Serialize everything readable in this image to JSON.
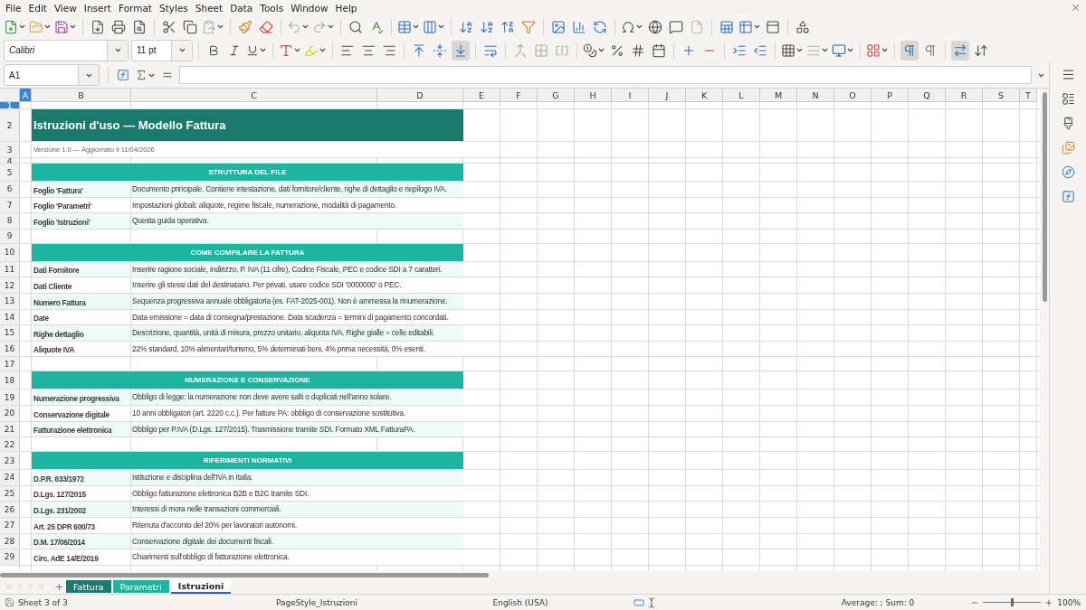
{
  "menu": [
    "File",
    "Edit",
    "View",
    "Insert",
    "Format",
    "Styles",
    "Sheet",
    "Data",
    "Tools",
    "Window",
    "Help"
  ],
  "font_name": {
    "value": "Calibri"
  },
  "font_size": {
    "value": "11 pt"
  },
  "format_toggles": [
    {
      "selected": true
    },
    {
      "selected": true
    },
    {
      "selected": false
    },
    {
      "selected": true
    },
    {
      "selected": false
    }
  ],
  "name_box": {
    "value": "A1"
  },
  "columns": [
    {
      "label": "A",
      "selected": true
    },
    {
      "label": "B",
      "selected": false
    },
    {
      "label": "C",
      "selected": false
    },
    {
      "label": "D",
      "selected": false
    },
    {
      "label": "E",
      "selected": false
    },
    {
      "label": "F",
      "selected": false
    },
    {
      "label": "G",
      "selected": false
    },
    {
      "label": "H",
      "selected": false
    },
    {
      "label": "I",
      "selected": false
    },
    {
      "label": "J",
      "selected": false
    },
    {
      "label": "K",
      "selected": false
    },
    {
      "label": "L",
      "selected": false
    },
    {
      "label": "M",
      "selected": false
    },
    {
      "label": "N",
      "selected": false
    },
    {
      "label": "O",
      "selected": false
    },
    {
      "label": "P",
      "selected": false
    },
    {
      "label": "Q",
      "selected": false
    },
    {
      "label": "R",
      "selected": false
    },
    {
      "label": "S",
      "selected": false
    },
    {
      "label": "T",
      "selected": false
    }
  ],
  "rows": [
    {
      "number": "1",
      "selected": true,
      "kind": "spacer"
    },
    {
      "number": "2",
      "selected": false,
      "kind": "title",
      "text": "Istruzioni d'uso — Modello Fattura"
    },
    {
      "number": "3",
      "selected": false,
      "kind": "subtitle",
      "text": "Versione 1.0 — Aggiornato il 11/04/2026"
    },
    {
      "number": "4",
      "selected": false,
      "kind": "thin"
    },
    {
      "number": "5",
      "selected": false,
      "kind": "section",
      "text": "STRUTTURA DEL FILE"
    },
    {
      "number": "6",
      "selected": false,
      "kind": "entry",
      "label": "Foglio 'Fattura'",
      "text": "Documento principale. Contiene intestazione, dati fornitore/cliente, righe di dettaglio e riepilogo IVA."
    },
    {
      "number": "7",
      "selected": false,
      "kind": "entry",
      "label": "Foglio 'Parametri'",
      "text": "Impostazioni globali: aliquote, regime fiscale, numerazione, modalità di pagamento."
    },
    {
      "number": "8",
      "selected": false,
      "kind": "entry",
      "label": "Foglio 'Istruzioni'",
      "text": "Questa guida operativa."
    },
    {
      "number": "9",
      "selected": false,
      "kind": "blank"
    },
    {
      "number": "10",
      "selected": false,
      "kind": "section",
      "text": "COME COMPILARE LA FATTURA"
    },
    {
      "number": "11",
      "selected": false,
      "kind": "entry",
      "label": "Dati Fornitore",
      "text": "Inserire ragione sociale, indirizzo, P. IVA (11 cifre), Codice Fiscale, PEC e codice SDI a 7 caratteri."
    },
    {
      "number": "12",
      "selected": false,
      "kind": "entry",
      "label": "Dati Cliente",
      "text": "Inserire gli stessi dati del destinatario. Per privati, usare codice SDI '0000000' o PEC."
    },
    {
      "number": "13",
      "selected": false,
      "kind": "entry",
      "label": "Numero Fattura",
      "text": "Sequenza progressiva annuale obbligatoria (es. FAT-2025-001). Non è ammessa la rinumerazione."
    },
    {
      "number": "14",
      "selected": false,
      "kind": "entry",
      "label": "Date",
      "text": "Data emissione = data di consegna/prestazione. Data scadenza = termini di pagamento concordati."
    },
    {
      "number": "15",
      "selected": false,
      "kind": "entry",
      "label": "Righe dettaglio",
      "text": "Descrizione, quantità, unità di misura, prezzo unitario, aliquota IVA. Righe gialle = celle editabili."
    },
    {
      "number": "16",
      "selected": false,
      "kind": "entry",
      "label": "Aliquote IVA",
      "text": "22% standard, 10% alimentari/turismo, 5% determinati beni, 4% prima necessità, 0% esenti."
    },
    {
      "number": "17",
      "selected": false,
      "kind": "blank"
    },
    {
      "number": "18",
      "selected": false,
      "kind": "section",
      "text": "NUMERAZIONE E CONSERVAZIONE"
    },
    {
      "number": "19",
      "selected": false,
      "kind": "entry",
      "label": "Numerazione progressiva",
      "text": "Obbligo di legge: la numerazione non deve avere salti o duplicati nell'anno solare."
    },
    {
      "number": "20",
      "selected": false,
      "kind": "entry",
      "label": "Conservazione digitale",
      "text": "10 anni obbligatori (art. 2220 c.c.). Per fatture PA: obbligo di conservazione sostitutiva."
    },
    {
      "number": "21",
      "selected": false,
      "kind": "entry",
      "label": "Fatturazione elettronica",
      "text": "Obbligo per P.IVA (D.Lgs. 127/2015). Trasmissione tramite SDI. Formato XML FatturaPA."
    },
    {
      "number": "22",
      "selected": false,
      "kind": "blank"
    },
    {
      "number": "23",
      "selected": false,
      "kind": "section",
      "text": "RIFERIMENTI NORMATIVI"
    },
    {
      "number": "24",
      "selected": false,
      "kind": "entry",
      "label": "D.P.R. 633/1972",
      "text": "Istituzione e disciplina dell'IVA in Italia."
    },
    {
      "number": "25",
      "selected": false,
      "kind": "entry",
      "label": "D.Lgs. 127/2015",
      "text": "Obbligo fatturazione elettronica B2B e B2C tramite SDI."
    },
    {
      "number": "26",
      "selected": false,
      "kind": "entry",
      "label": "D.Lgs. 231/2002",
      "text": "Interessi di mora nelle transazioni commerciali."
    },
    {
      "number": "27",
      "selected": false,
      "kind": "entry",
      "label": "Art. 25 DPR 600/73",
      "text": "Ritenuta d'acconto del 20% per lavoratori autonomi."
    },
    {
      "number": "28",
      "selected": false,
      "kind": "entry",
      "label": "D.M. 17/06/2014",
      "text": "Conservazione digitale dei documenti fiscali."
    },
    {
      "number": "29",
      "selected": false,
      "kind": "entry",
      "label": "Circ. AdE 14/E/2019",
      "text": "Chiarimenti sull'obbligo di fatturazione elettronica."
    }
  ],
  "sheet_tabs": [
    {
      "label": "Fattura",
      "selected": false,
      "color": "#1d7a6e"
    },
    {
      "label": "Parametri",
      "selected": false,
      "color": "#1cb5a0"
    },
    {
      "label": "Istruzioni",
      "selected": true,
      "color": "#ffffff"
    }
  ],
  "status_bar": {
    "sheet": "Sheet 3 of 3",
    "page_style": "PageStyle_Istruzioni",
    "language": "English (USA)",
    "summary": "Average: ; Sum: 0",
    "zoom_slider": {
      "level": 0.5
    },
    "zoom": "100%"
  }
}
